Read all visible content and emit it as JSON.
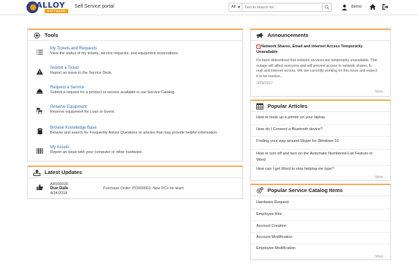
{
  "header": {
    "logo_text": "ALLOY",
    "logo_sub": "SOFTWARE",
    "portal_title": "Self Service portal",
    "search_scope": "All",
    "search_placeholder": "Text to search for...",
    "user_name": "demo",
    "icons": {
      "user": "user-icon",
      "home": "home-icon",
      "logout": "logout-icon",
      "search": "search-icon"
    }
  },
  "tools": {
    "title": "Tools",
    "items": [
      {
        "name": "My Tickets and Requests",
        "desc": "View the status of my tickets, service requests, and equipment reservations.",
        "icon": "list-icon"
      },
      {
        "name": "Submit a Ticket",
        "desc": "Report an issue to the Service Desk.",
        "icon": "warning-icon"
      },
      {
        "name": "Request a Service",
        "desc": "Submit a request for a product or service available in our Service Catalog.",
        "icon": "service-bell-icon"
      },
      {
        "name": "Reserve Equipment",
        "desc": "Reserve equipment for Loan or Event.",
        "icon": "equipment-cart-icon"
      },
      {
        "name": "Browse Knowledge Base",
        "desc": "Browse and search for Frequently Asked Questions or articles that may provide helpful information.",
        "icon": "book-icon"
      },
      {
        "name": "My Assets",
        "desc": "Report an issue with your computer or other hardware.",
        "icon": "barcode-icon"
      }
    ]
  },
  "latest_updates": {
    "title": "Latest Updates",
    "items": [
      {
        "id": "AR000030",
        "label": "Due Date",
        "date": "4/24/2018",
        "description": "Purchase Order; PO000063; New PCs for team",
        "icon": "thumbs-up-icon"
      }
    ]
  },
  "announcements": {
    "title": "Announcements",
    "item_title": "Network Shares, Email and Internet Access Temporarily Unavailable",
    "item_body": "It's been determined that network services are temporarily unavailable. This outage will affect everyone and will prevent access to network shares, E-mail and internet access.   We are currently working on this issue and expect it to be resolve...",
    "item_date": "3/29/2017",
    "more": "More..."
  },
  "popular_articles": {
    "title": "Popular Articles",
    "items": [
      "How to hook up a printer on your laptop",
      "How do I Connect a Bluetooth device?",
      "Finding your way around Skype for Windows 10",
      "How to turn off and turn on the Automatic Numbered-List Feature in Word",
      "How can I get Word to stop helping me type?"
    ],
    "more": "More..."
  },
  "popular_catalog": {
    "title": "Popular Service Catalog Items",
    "items": [
      "Hardware Request",
      "Employee Hire",
      "Account Creation",
      "Account Modification",
      "Employee Modification"
    ],
    "more": "More..."
  },
  "colors": {
    "accent": "#f4a85c",
    "link": "#2a6db5",
    "brand_blue": "#233a80",
    "brand_orange": "#f39c12"
  }
}
